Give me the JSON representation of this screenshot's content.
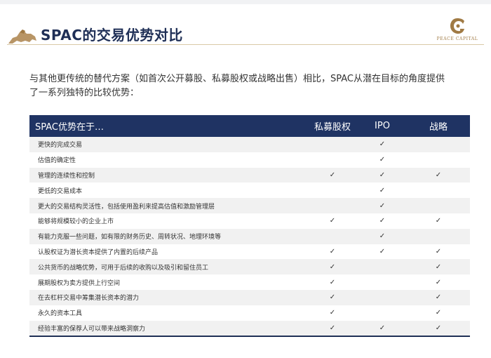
{
  "header": {
    "title": "SPAC的交易优势对比",
    "logo_text": "PEACE CAPITAL"
  },
  "intro": "与其他更传统的替代方案（如首次公开募股、私募股权或战略出售）相比，SPAC从潜在目标的角度提供了一系列独特的比较优势：",
  "table": {
    "headers": [
      "SPAC优势在于…",
      "私募股权",
      "IPO",
      "战略"
    ],
    "check": "✓",
    "rows": [
      {
        "label": "更快的完成交易",
        "pe": false,
        "ipo": true,
        "strategic": false
      },
      {
        "label": "估值的确定性",
        "pe": false,
        "ipo": true,
        "strategic": false
      },
      {
        "label": "管理的连续性和控制",
        "pe": true,
        "ipo": true,
        "strategic": true
      },
      {
        "label": "更低的交易成本",
        "pe": false,
        "ipo": true,
        "strategic": false
      },
      {
        "label": "更大的交易结构灵活性，包括使用盈利来提高估值和激励管理层",
        "pe": false,
        "ipo": true,
        "strategic": false
      },
      {
        "label": "能够将规模较小的企业上市",
        "pe": true,
        "ipo": true,
        "strategic": true
      },
      {
        "label": "有能力克服一些问题，如有限的财务历史、周转状况、地理环境等",
        "pe": false,
        "ipo": true,
        "strategic": false
      },
      {
        "label": "认股权证为潜长资本提供了内置的后续产品",
        "pe": true,
        "ipo": true,
        "strategic": true
      },
      {
        "label": "公共货币的战略优势，可用于后续的收购以及吸引和留住员工",
        "pe": true,
        "ipo": false,
        "strategic": true
      },
      {
        "label": "展期股权为卖方提供上行空间",
        "pe": true,
        "ipo": false,
        "strategic": true
      },
      {
        "label": "在去杠杆交易中筹集潜长资本的潜力",
        "pe": true,
        "ipo": false,
        "strategic": true
      },
      {
        "label": "永久的资本工具",
        "pe": true,
        "ipo": false,
        "strategic": true
      },
      {
        "label": "经验丰富的保荐人可以带来战略洞察力",
        "pe": true,
        "ipo": true,
        "strategic": true
      }
    ]
  }
}
